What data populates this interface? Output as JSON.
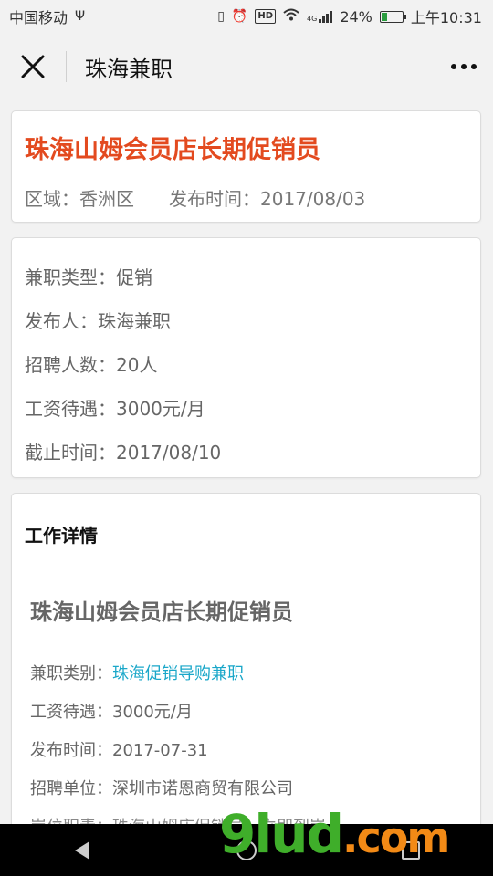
{
  "status_bar": {
    "carrier": "中国移动",
    "usb_icon": "usb-icon",
    "network_label": "4G",
    "battery_percent": "24%",
    "time": "上午10:31"
  },
  "nav": {
    "title": "珠海兼职",
    "close_icon": "close-icon",
    "more_icon": "more-icon"
  },
  "header_card": {
    "title": "珠海山姆会员店长期促销员",
    "region": "区域：香洲区",
    "publish_time": "发布时间：2017/08/03"
  },
  "info_card": {
    "rows": [
      "兼职类型：促销",
      "发布人：珠海兼职",
      "招聘人数：20人",
      "工资待遇：3000元/月",
      "截止时间：2017/08/10"
    ]
  },
  "detail_card": {
    "section_title": "工作详情",
    "title": "珠海山姆会员店长期促销员",
    "category_label": "兼职类别：",
    "category_link": "珠海促销导购兼职",
    "salary": "工资待遇：3000元/月",
    "publish_time": "发布时间：2017-07-31",
    "company": "招聘单位：深圳市诺恩商贸有限公司",
    "duty_partial": "岗位职责：珠海山姆店促销员，立即到岗"
  },
  "watermark": {
    "main": "9lud",
    "suffix": ".com"
  },
  "colors": {
    "title_accent": "#e34a1f",
    "link": "#1aa7c9",
    "watermark_green": "#3fae2a",
    "watermark_orange": "#f28a16"
  }
}
